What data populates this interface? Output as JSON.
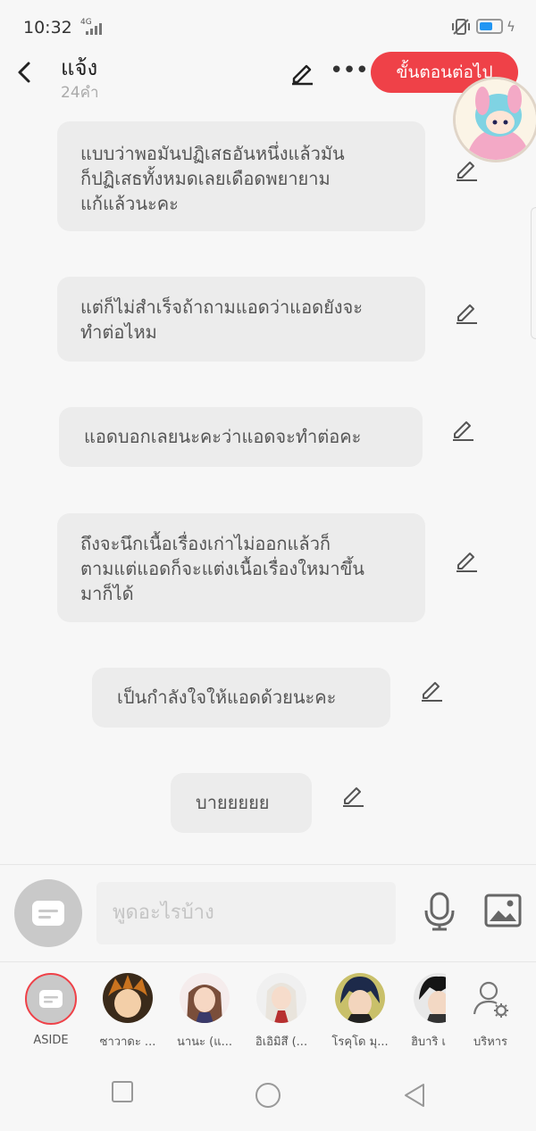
{
  "status_bar": {
    "time": "10:32",
    "network": "4G"
  },
  "header": {
    "title": "แจ้ง",
    "subtitle": "24คำ",
    "next_button": "ขั้นตอนต่อไป"
  },
  "messages": [
    {
      "lines": [
        "แบบว่าพอมันปฏิเสธอันหนึ่งแล้วมัน",
        "ก็ปฏิเสธทั้งหมดเลยเดือดพยายาม",
        "แก้แล้วนะคะ"
      ]
    },
    {
      "lines": [
        "แต่ก็ไม่สำเร็จถ้าถามแอดว่าแอดยังจะ",
        "ทำต่อไหม"
      ]
    },
    {
      "lines": [
        "แอดบอกเลยนะคะว่าแอดจะทำต่อคะ"
      ]
    },
    {
      "lines": [
        "ถึงจะนึกเนื้อเรื่องเก่าไม่ออกแล้วก็",
        "ตามแต่แอดก็จะแต่งเนื้อเรื่องใหมาขึ้น",
        "มาก็ได้"
      ]
    },
    {
      "lines": [
        "เป็นกำลังใจให้แอดด้วยนะคะ"
      ]
    },
    {
      "lines": [
        "บายยยยย"
      ]
    }
  ],
  "composer": {
    "placeholder": "พูดอะไรบ้าง"
  },
  "characters": [
    {
      "label": "ASIDE"
    },
    {
      "label": "ซาวาดะ ..."
    },
    {
      "label": "นานะ (แ..."
    },
    {
      "label": "อิเอิมิสึ (..."
    },
    {
      "label": "โรคุโด มุ..."
    },
    {
      "label": "ฮิบาริ เ"
    },
    {
      "label": "บริหาร"
    }
  ],
  "colors": {
    "accent": "#ef4148",
    "bubble": "#ececec",
    "background": "#f7f7f7"
  }
}
